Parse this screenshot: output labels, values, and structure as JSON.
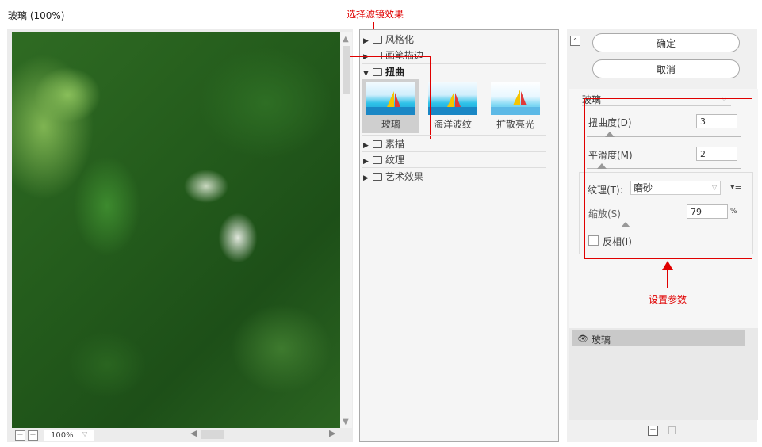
{
  "window": {
    "title": "玻璃 (100%)"
  },
  "annotations": {
    "select_filter": "选择滤镜效果",
    "set_params": "设置参数",
    "accent_color": "#e00000"
  },
  "preview": {
    "zoom": "100%",
    "zoom_minus": "−",
    "zoom_plus": "+"
  },
  "gallery": {
    "categories": [
      {
        "label": "风格化",
        "expanded": false
      },
      {
        "label": "画笔描边",
        "expanded": false
      },
      {
        "label": "扭曲",
        "expanded": true
      },
      {
        "label": "素描",
        "expanded": false
      },
      {
        "label": "纹理",
        "expanded": false
      },
      {
        "label": "艺术效果",
        "expanded": false
      }
    ],
    "thumbnails": [
      {
        "label": "玻璃",
        "selected": true
      },
      {
        "label": "海洋波纹",
        "selected": false
      },
      {
        "label": "扩散亮光",
        "selected": false
      }
    ]
  },
  "buttons": {
    "ok": "确定",
    "cancel": "取消"
  },
  "settings": {
    "filter": "玻璃",
    "distortion": {
      "label": "扭曲度(D)",
      "value": "3",
      "level": 0.15
    },
    "smoothness": {
      "label": "平滑度(M)",
      "value": "2",
      "level": 0.1
    },
    "texture": {
      "label": "纹理(T):",
      "value": "磨砂"
    },
    "scaling": {
      "label": "缩放(S)",
      "value": "79",
      "unit": "%",
      "level": 0.25
    },
    "invert": {
      "label": "反相(I)",
      "checked": false
    }
  },
  "layers": [
    {
      "name": "玻璃",
      "visible": true
    }
  ],
  "icons": {
    "eye": "eye-icon",
    "add": "new-layer-icon",
    "delete": "trash-icon"
  }
}
